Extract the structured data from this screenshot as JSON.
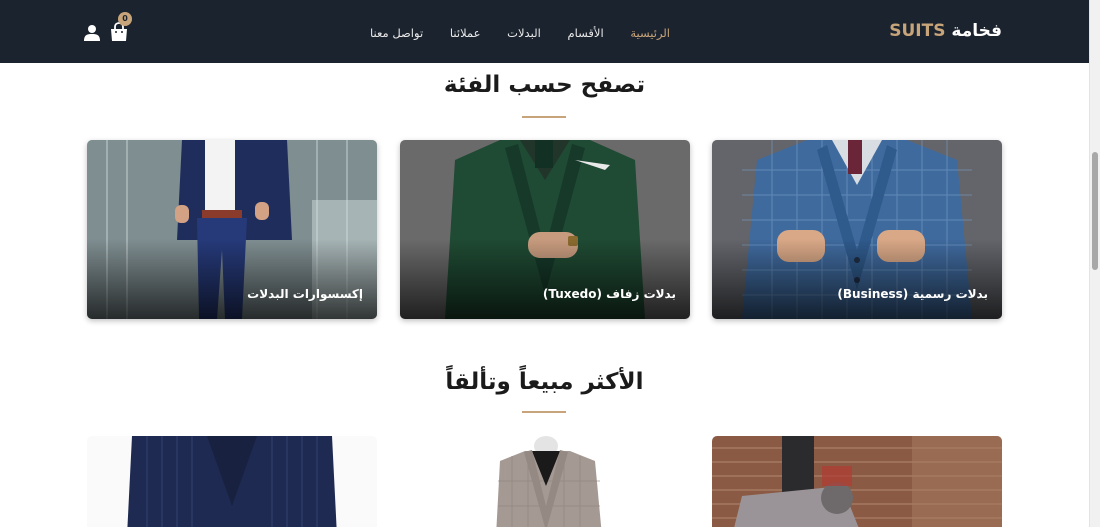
{
  "navbar": {
    "brand_main": "فخامة",
    "brand_accent": "SUITS",
    "links": [
      "الرئيسية",
      "الأقسام",
      "البدلات",
      "عملائنا",
      "تواصل معنا"
    ],
    "active_link": "الرئيسية",
    "cart_count": "0",
    "user_icon": "user-icon",
    "cart_icon": "shopping-bag-icon"
  },
  "categories": {
    "title": "تصفح حسب الفئة",
    "items": [
      {
        "label": "بدلات رسمية (Business)"
      },
      {
        "label": "بدلات زفاف (Tuxedo)"
      },
      {
        "label": "إكسسوارات البدلات"
      }
    ]
  },
  "bestsellers": {
    "title": "الأكثر مبيعاً وتألقاً"
  },
  "colors": {
    "navbar_bg": "#1b232e",
    "accent": "#c8a47a",
    "text_dark": "#1b1b1b"
  }
}
